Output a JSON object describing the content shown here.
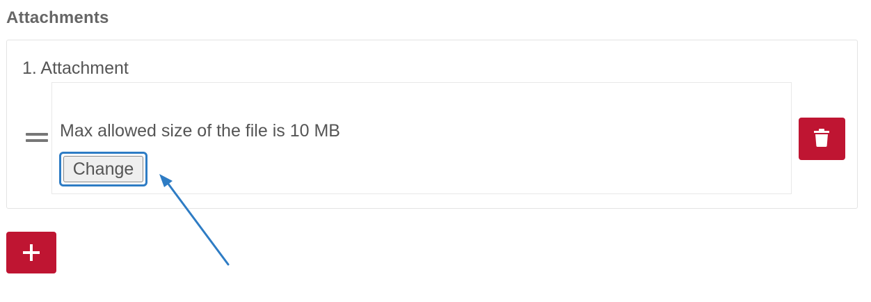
{
  "section": {
    "title": "Attachments"
  },
  "attachments": [
    {
      "label": "1. Attachment",
      "help_text": "Max allowed size of the file is 10 MB",
      "change_label": "Change"
    }
  ],
  "icons": {
    "drag": "drag-handle-icon",
    "delete": "trash-icon",
    "add": "plus-icon"
  },
  "colors": {
    "danger": "#bf1532",
    "highlight": "#2e7cc4"
  }
}
